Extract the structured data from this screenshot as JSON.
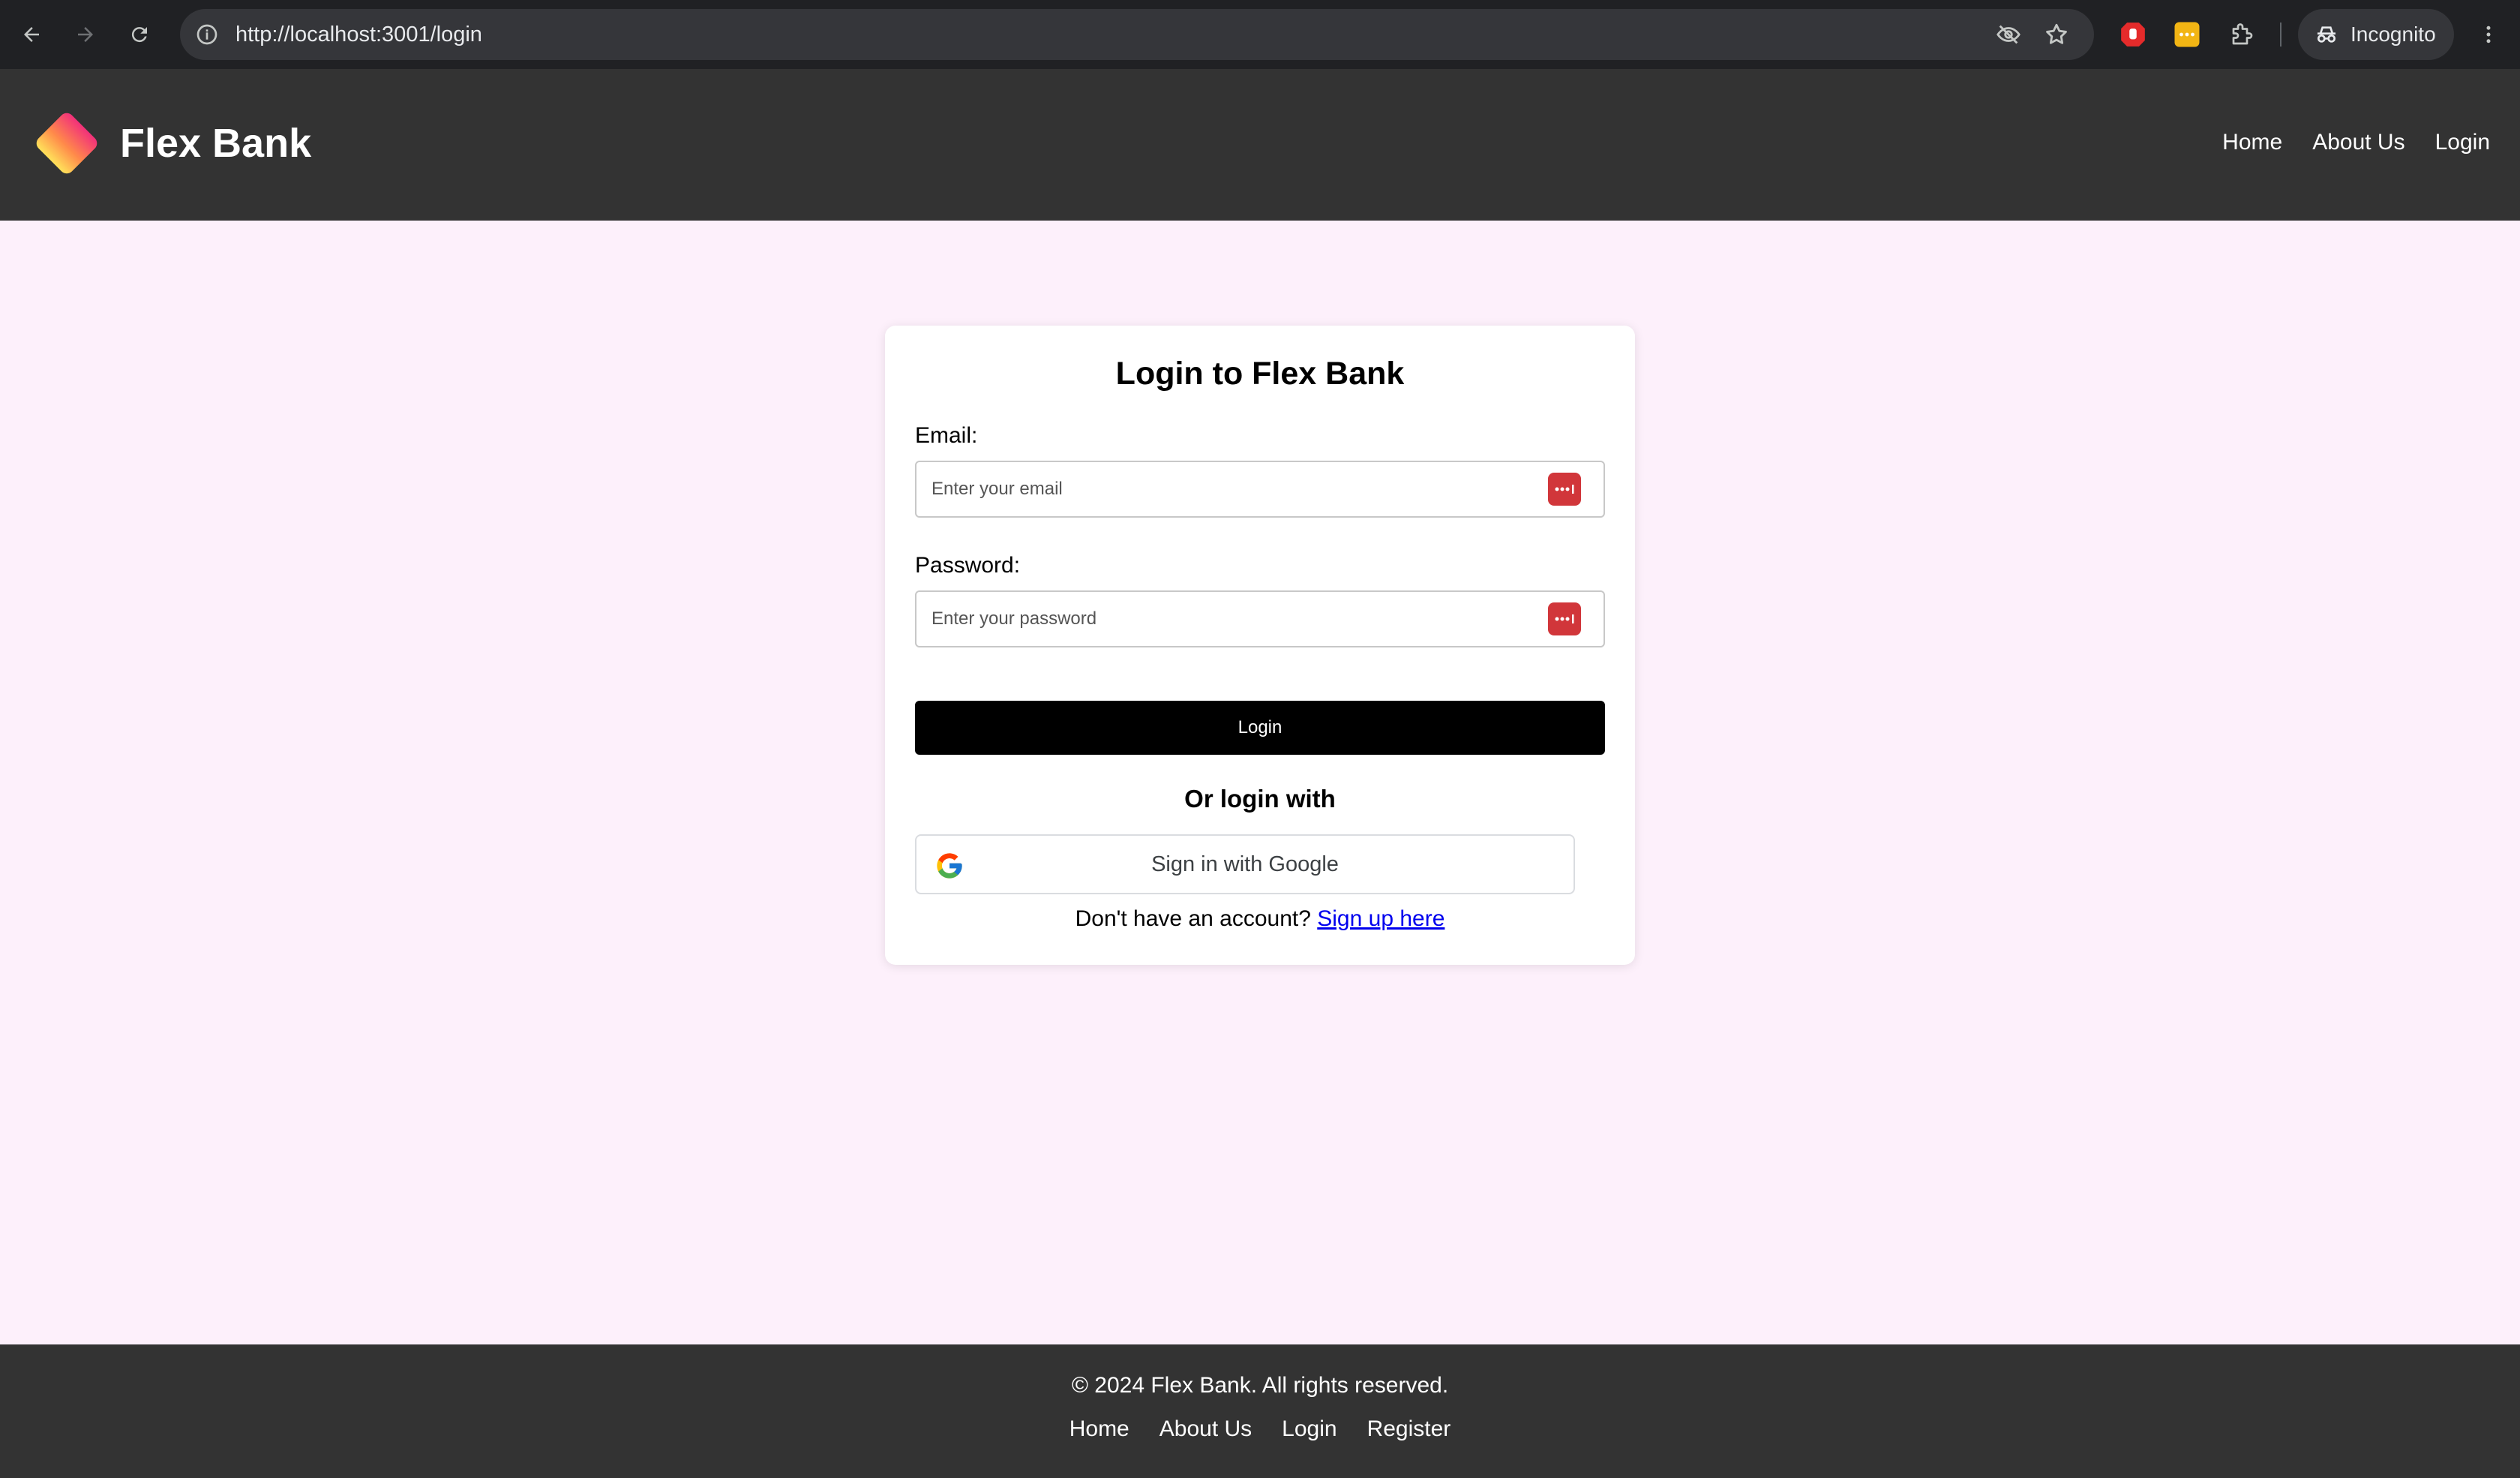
{
  "browser": {
    "url": "http://localhost:3001/login",
    "incognito_label": "Incognito",
    "icons": [
      "back-arrow-icon",
      "forward-arrow-icon",
      "reload-icon",
      "site-info-icon",
      "eye-off-icon",
      "star-icon",
      "adblock-icon",
      "password-manager-icon",
      "puzzle-icon",
      "incognito-icon",
      "kebab-menu-icon"
    ]
  },
  "header": {
    "brand": "Flex Bank",
    "nav": [
      "Home",
      "About Us",
      "Login"
    ]
  },
  "login_card": {
    "title": "Login to Flex Bank",
    "email_label": "Email:",
    "email_placeholder": "Enter your email",
    "email_value": "",
    "password_label": "Password:",
    "password_placeholder": "Enter your password",
    "password_value": "",
    "login_button": "Login",
    "or_login_with": "Or login with",
    "google_button": "Sign in with Google",
    "signup_prompt": "Don't have an account?",
    "signup_link": "Sign up here"
  },
  "footer": {
    "copyright": "© 2024 Flex Bank. All rights reserved.",
    "nav": [
      "Home",
      "About Us",
      "Login",
      "Register"
    ]
  },
  "colors": {
    "header_bg": "#333333",
    "page_bg": "#fdf0fb",
    "login_button_bg": "#000000",
    "password_manager_red": "#d1363a",
    "link": "#0000ee"
  }
}
